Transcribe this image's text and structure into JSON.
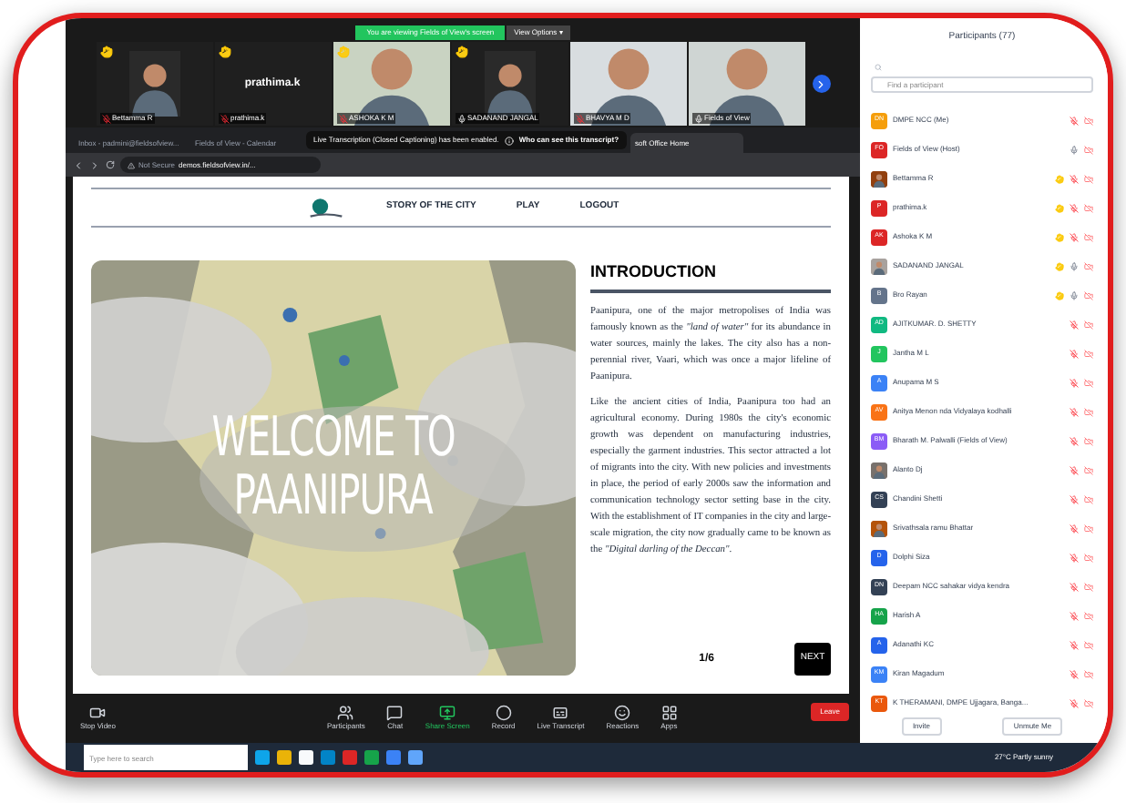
{
  "share_banner": {
    "text": "You are viewing Fields of View's screen",
    "options": "View Options ▾"
  },
  "video_tiles": [
    {
      "name": "Bettamma R",
      "muted": true,
      "hand_raised": true
    },
    {
      "name": "prathima.k",
      "kind": "name",
      "display_name": "prathima.k",
      "muted": true,
      "hand_raised": true
    },
    {
      "name": "ASHOKA K M",
      "muted": true,
      "hand_raised": true
    },
    {
      "name": "SADANAND JANGAL",
      "muted": false,
      "hand_raised": true
    },
    {
      "name": "BHAVYA M D",
      "muted": true,
      "hand_raised": false
    },
    {
      "name": "Fields of View",
      "muted": false,
      "hand_raised": false
    }
  ],
  "browser": {
    "tabs": [
      {
        "title": "Inbox - padmini@fieldsofview...",
        "selected": false
      },
      {
        "title": "Fields of View - Calendar",
        "selected": false
      },
      {
        "title": "soft Office Home",
        "selected": true
      }
    ],
    "toast": {
      "text": "Live Transcription (Closed Captioning) has been enabled.",
      "link": "Who can see this transcript?"
    },
    "security": "Not Secure",
    "url": "demos.fieldsofview.in/..."
  },
  "site": {
    "nav": [
      "STORY OF THE CITY",
      "PLAY",
      "LOGOUT"
    ],
    "hero": [
      "WELCOME TO",
      "PAANIPURA"
    ],
    "heading": "INTRODUCTION",
    "paragraphs": [
      "Paanipura, one of the major metropolises of India was famously known as the *\"land of water\"* for its abundance in water sources, mainly the lakes. The city also has a non-perennial river, Vaari, which was once a major lifeline of Paanipura.",
      "Like the ancient cities of India, Paanipura too had an agricultural economy. During 1980s the city's economic growth was dependent on manufacturing industries, especially the garment industries. This sector attracted a lot of migrants into the city. With new policies and investments in place, the period of early 2000s saw the information and communication technology sector setting base in the city. With the establishment of IT companies in the city and large-scale migration, the city now gradually came to be known as the *\"Digital darling of the Deccan\"*."
    ],
    "page": "1/6",
    "next": "NEXT"
  },
  "toolbar": [
    {
      "label": "Stop Video",
      "kind": "video",
      "active": false
    },
    {
      "label": "Participants",
      "kind": "users",
      "active": false
    },
    {
      "label": "Chat",
      "kind": "chat",
      "active": false
    },
    {
      "label": "Share Screen",
      "kind": "share",
      "active": true
    },
    {
      "label": "Record",
      "kind": "record",
      "active": false
    },
    {
      "label": "Live Transcript",
      "kind": "cc",
      "active": false
    },
    {
      "label": "Reactions",
      "kind": "smile",
      "active": false
    },
    {
      "label": "Apps",
      "kind": "apps",
      "active": false
    }
  ],
  "leave": "Leave",
  "participants": {
    "title": "Participants (77)",
    "placeholder": "Find a participant",
    "items": [
      {
        "name": "DMPE NCC (Me)",
        "kind": "initials",
        "initials": "DN",
        "color": "#f59e0b",
        "muted": true,
        "hand_raised": false
      },
      {
        "name": "Fields of View (Host)",
        "kind": "initials",
        "initials": "FO",
        "color": "#dc2626",
        "muted": false,
        "hand_raised": false
      },
      {
        "name": "Bettamma R",
        "color": "#92400e",
        "muted": true,
        "hand_raised": true
      },
      {
        "name": "prathima.k",
        "kind": "initials",
        "initials": "P",
        "color": "#dc2626",
        "muted": true,
        "hand_raised": true
      },
      {
        "name": "Ashoka K M",
        "kind": "initials",
        "initials": "AK",
        "color": "#dc2626",
        "muted": true,
        "hand_raised": true
      },
      {
        "name": "SADANAND JANGAL",
        "color": "#a8a29e",
        "muted": false,
        "hand_raised": true
      },
      {
        "name": "Bro Rayan",
        "kind": "initials",
        "initials": "B",
        "color": "#64748b",
        "muted": false,
        "hand_raised": true
      },
      {
        "name": "AJITKUMAR. D. SHETTY",
        "kind": "initials",
        "initials": "AD",
        "color": "#10b981",
        "muted": true,
        "hand_raised": false
      },
      {
        "name": "Jantha M L",
        "kind": "initials",
        "initials": "J",
        "color": "#22c55e",
        "muted": true,
        "hand_raised": false
      },
      {
        "name": "Anupama M S",
        "kind": "initials",
        "initials": "A",
        "color": "#3b82f6",
        "muted": true,
        "hand_raised": false
      },
      {
        "name": "Anitya Menon nda Vidyalaya kodhalli",
        "kind": "initials",
        "initials": "AV",
        "color": "#f97316",
        "muted": true,
        "hand_raised": false
      },
      {
        "name": "Bharath M. Palwalli (Fields of View)",
        "kind": "initials",
        "initials": "BM",
        "color": "#8b5cf6",
        "muted": true,
        "hand_raised": false
      },
      {
        "name": "Alanto Dj",
        "color": "#78716c",
        "muted": true,
        "hand_raised": false
      },
      {
        "name": "Chandini Shetti",
        "kind": "initials",
        "initials": "CS",
        "color": "#334155",
        "muted": true,
        "hand_raised": false
      },
      {
        "name": "Srivathsala ramu Bhattar",
        "color": "#b45309",
        "muted": true,
        "hand_raised": false
      },
      {
        "name": "Dolphi Siza",
        "kind": "initials",
        "initials": "D",
        "color": "#2563eb",
        "muted": true,
        "hand_raised": false
      },
      {
        "name": "Deepam NCC sahakar vidya kendra",
        "kind": "initials",
        "initials": "DN",
        "color": "#334155",
        "muted": true,
        "hand_raised": false
      },
      {
        "name": "Harish A",
        "kind": "initials",
        "initials": "HA",
        "color": "#16a34a",
        "muted": true,
        "hand_raised": false
      },
      {
        "name": "Adanathi KC",
        "kind": "initials",
        "initials": "A",
        "color": "#2563eb",
        "muted": true,
        "hand_raised": false
      },
      {
        "name": "Kiran Magadum",
        "kind": "initials",
        "initials": "KM",
        "color": "#3b82f6",
        "muted": true,
        "hand_raised": false
      },
      {
        "name": "K THERAMANI, DMPE Ujjagara, Banga...",
        "kind": "initials",
        "initials": "KT",
        "color": "#ea580c",
        "muted": true,
        "hand_raised": false
      }
    ],
    "buttons": [
      "Invite",
      "Unmute Me"
    ]
  },
  "taskbar": {
    "placeholder": "Type here to search",
    "weather": "27°C Partly sunny"
  }
}
